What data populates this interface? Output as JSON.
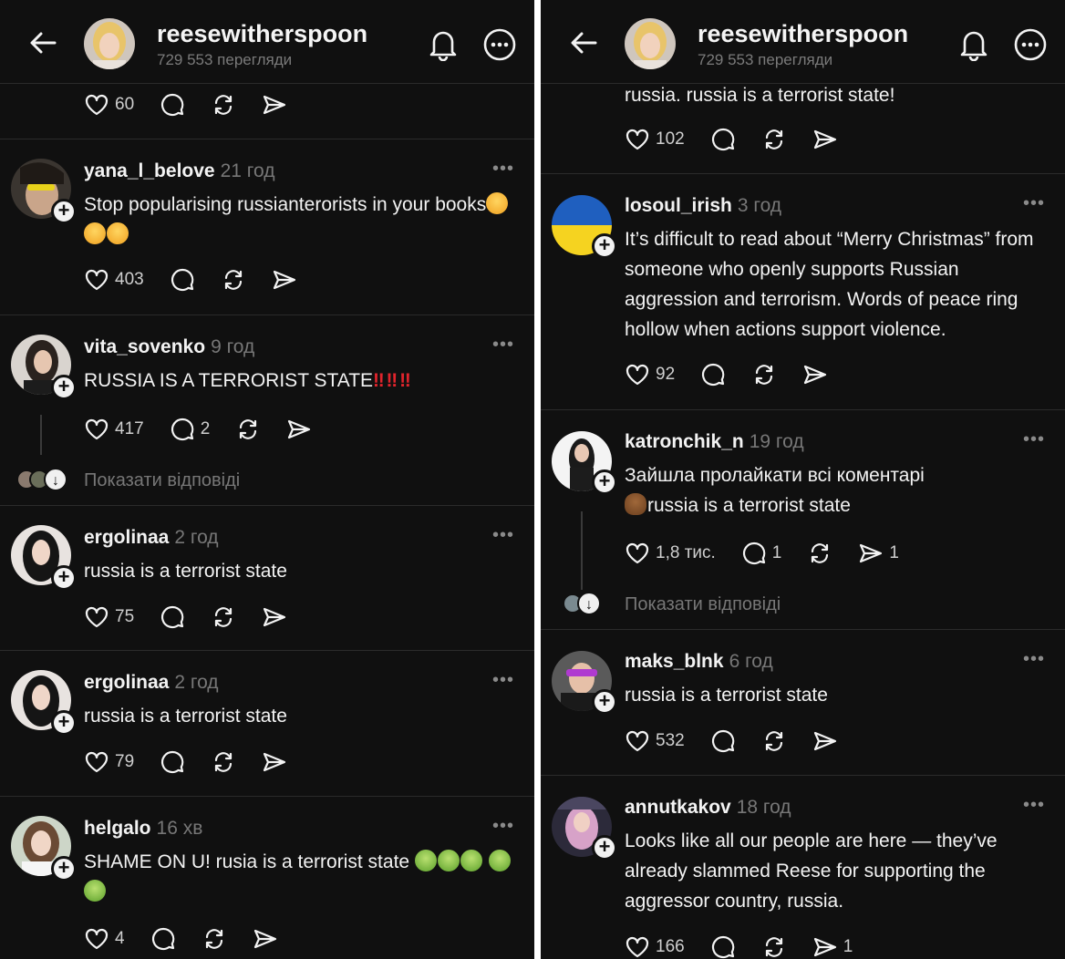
{
  "left": {
    "header": {
      "username": "reesewitherspoon",
      "views": "729 553 перегляди"
    },
    "top_likes": "60",
    "comments": [
      {
        "user": "yana_l_belove",
        "time": "21 год",
        "text": "Stop popularising russianterorists in your books",
        "likes": "403"
      },
      {
        "user": "vita_sovenko",
        "time": "9 год",
        "text": "RUSSIA IS A TERRORIST STATE",
        "likes": "417",
        "replies_count": "2",
        "show_replies": "Показати відповіді"
      },
      {
        "user": "ergolinaa",
        "time": "2 год",
        "text": "russia is a terrorist state",
        "likes": "75"
      },
      {
        "user": "ergolinaa",
        "time": "2 год",
        "text": "russia is a terrorist state",
        "likes": "79"
      },
      {
        "user": "helgalo",
        "time": "16 хв",
        "text": "SHAME ON U! rusia is a terrorist state",
        "likes": "4"
      }
    ]
  },
  "right": {
    "header": {
      "username": "reesewitherspoon",
      "views": "729 553 перегляди"
    },
    "top_text": "russia. russia is a terrorist state!",
    "top_likes": "102",
    "comments": [
      {
        "user": "losoul_irish",
        "time": "3 год",
        "text": "It’s difficult to read about “Merry Christmas” from someone who openly supports Russian aggression and terrorism. Words of peace ring hollow when actions support violence.",
        "likes": "92"
      },
      {
        "user": "katronchik_n",
        "time": "19 год",
        "text_line1": "Зайшла пролайкати всі коментарі",
        "text_line2": "russia is a terrorist state",
        "likes": "1,8 тис.",
        "replies_count": "1",
        "shares": "1",
        "show_replies": "Показати відповіді"
      },
      {
        "user": "maks_blnk",
        "time": "6 год",
        "text": "russia is a terrorist state",
        "likes": "532"
      },
      {
        "user": "annutkakov",
        "time": "18 год",
        "text": "Looks like all our people are here — they’ve already slammed Reese for supporting the aggressor country, russia.",
        "likes": "166",
        "shares": "1"
      }
    ]
  },
  "colors": {
    "background": "#101010",
    "text": "#f3f3f3",
    "muted": "#777777",
    "separator": "#2b2b2b"
  }
}
